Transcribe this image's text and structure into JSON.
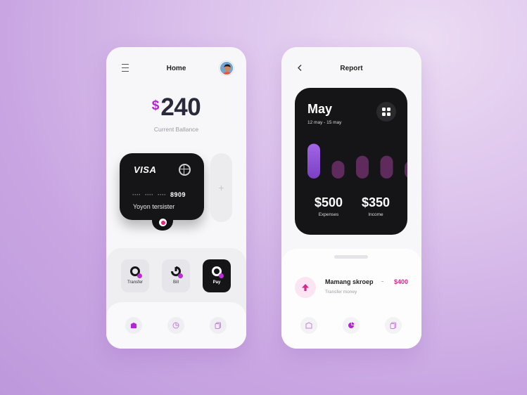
{
  "home": {
    "title": "Home",
    "balance": {
      "currency": "$",
      "amount": "240",
      "label": "Current Ballance"
    },
    "card": {
      "brand": "VISA",
      "mask": [
        "····",
        "····",
        "····"
      ],
      "last4": "8909",
      "holder": "Yoyon tersister"
    },
    "add_label": "+",
    "actions": [
      {
        "label": "Transfer",
        "icon": "transfer-icon"
      },
      {
        "label": "Bill",
        "icon": "bill-icon"
      },
      {
        "label": "Pay",
        "icon": "pay-icon"
      }
    ],
    "nav": [
      "wallet-icon",
      "pie-chart-icon",
      "cards-icon"
    ],
    "active_nav": 0
  },
  "report": {
    "title": "Report",
    "month": "May",
    "range": "12 may - 15 may",
    "chart_data": {
      "type": "bar",
      "categories": [
        "",
        "",
        "",
        "",
        ""
      ],
      "values": [
        55,
        28,
        36,
        36,
        28
      ],
      "highlight_index": 0,
      "ylim": [
        0,
        60
      ]
    },
    "stats": [
      {
        "value": "$500",
        "label": "Expenses"
      },
      {
        "value": "$350",
        "label": "Income"
      }
    ],
    "transaction": {
      "name": "Mamang skroep",
      "subtitle": "Transfer money",
      "amount": "$400",
      "icon": "arrow-up-icon"
    },
    "nav": [
      "wallet-icon",
      "pie-chart-icon",
      "cards-icon"
    ],
    "active_nav": 1
  },
  "colors": {
    "accent": "#b423d6",
    "pink": "#e9267a",
    "dark": "#151517",
    "bar_highlight": "#9a57d9",
    "bar": "#5e2b5c"
  }
}
